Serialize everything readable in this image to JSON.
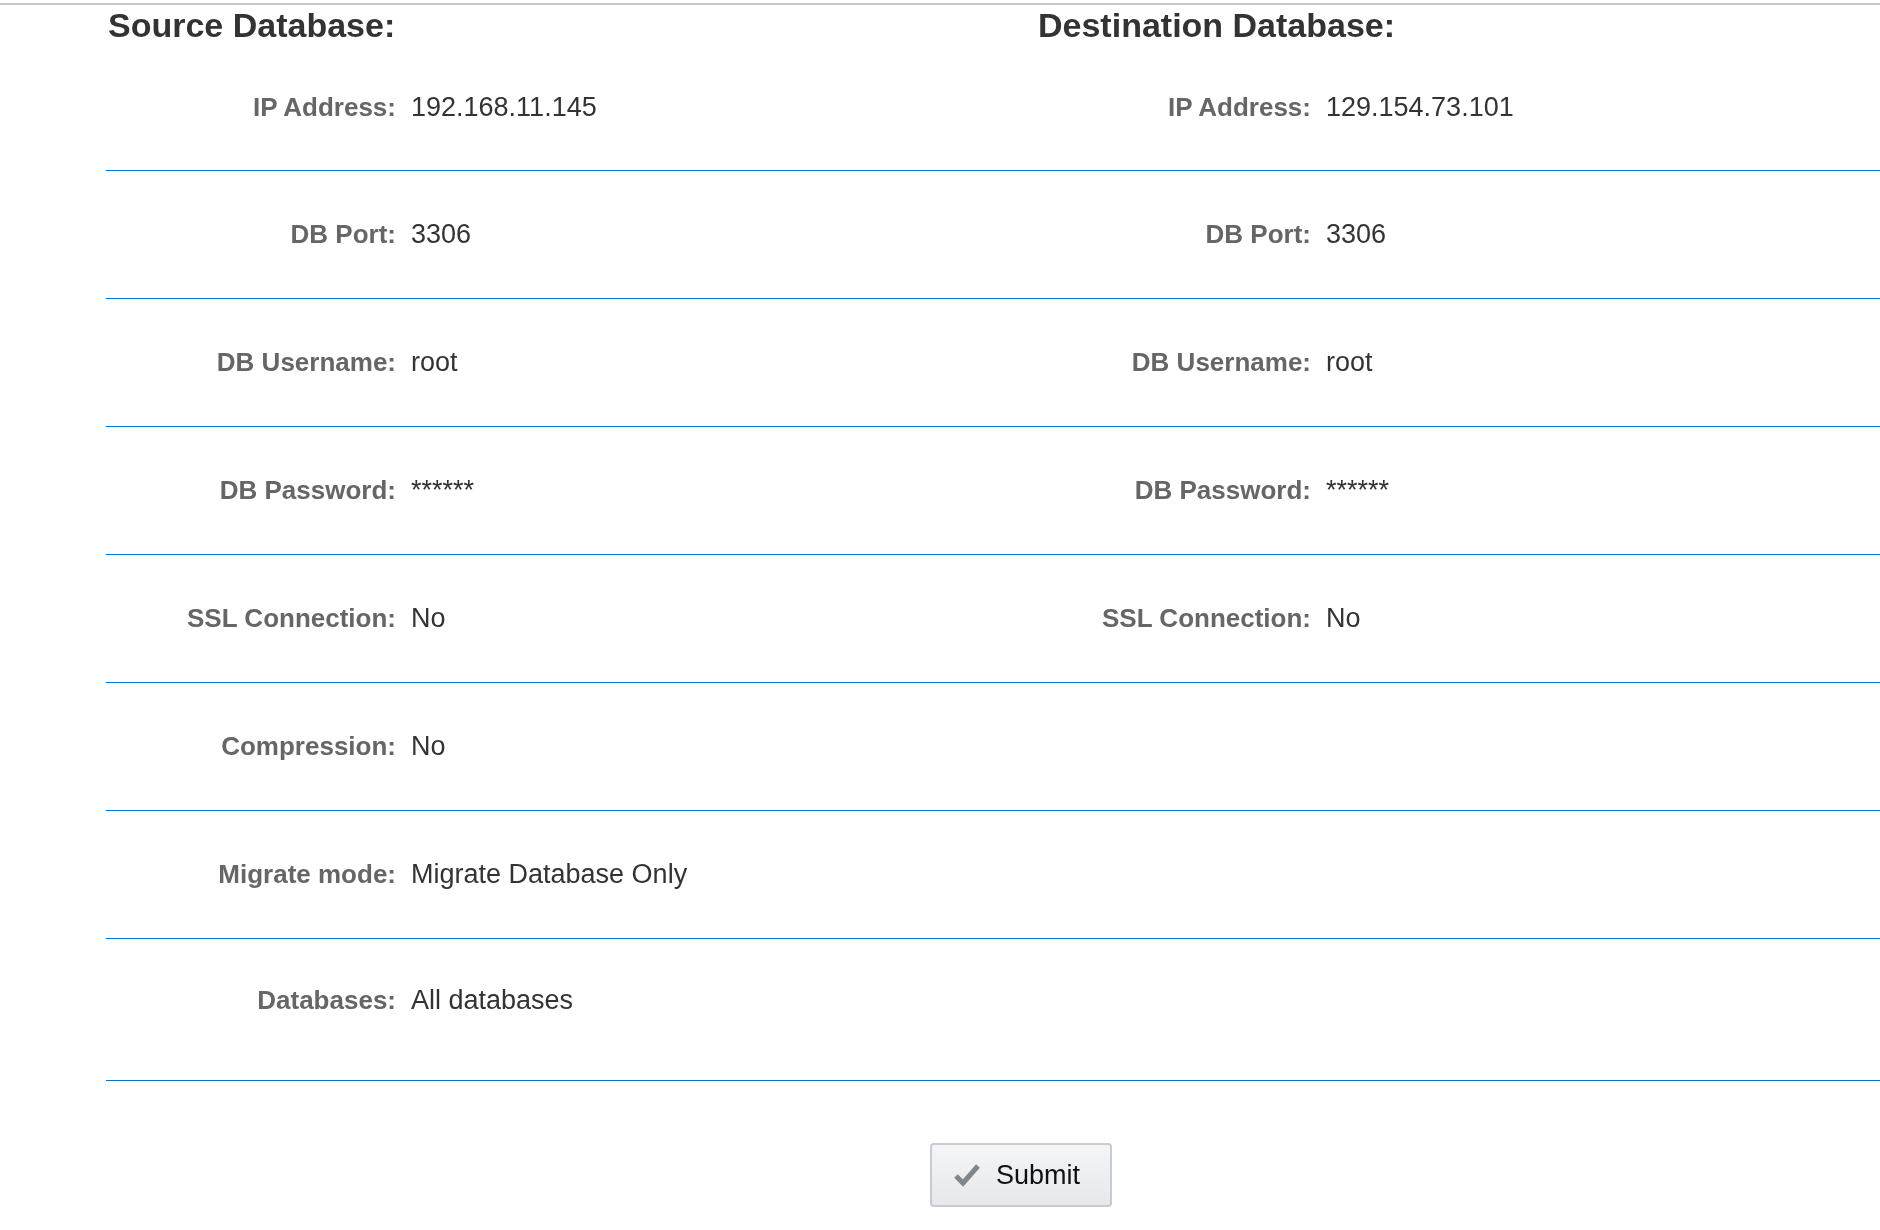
{
  "source": {
    "heading": "Source Database:"
  },
  "destination": {
    "heading": "Destination Database:"
  },
  "rows": [
    {
      "source": {
        "label": "IP Address:",
        "value": "192.168.11.145"
      },
      "destination": {
        "label": "IP Address:",
        "value": "129.154.73.101"
      }
    },
    {
      "source": {
        "label": "DB Port:",
        "value": "3306"
      },
      "destination": {
        "label": "DB Port:",
        "value": "3306"
      }
    },
    {
      "source": {
        "label": "DB Username:",
        "value": "root"
      },
      "destination": {
        "label": "DB Username:",
        "value": "root"
      }
    },
    {
      "source": {
        "label": "DB Password:",
        "value": "******"
      },
      "destination": {
        "label": "DB Password:",
        "value": "******"
      }
    },
    {
      "source": {
        "label": "SSL Connection:",
        "value": "No"
      },
      "destination": {
        "label": "SSL Connection:",
        "value": "No"
      }
    },
    {
      "source": {
        "label": "Compression:",
        "value": "No"
      }
    },
    {
      "source": {
        "label": "Migrate mode:",
        "value": "Migrate Database Only"
      }
    },
    {
      "source": {
        "label": "Databases:",
        "value": "All databases"
      }
    }
  ],
  "submit": {
    "label": "Submit"
  }
}
